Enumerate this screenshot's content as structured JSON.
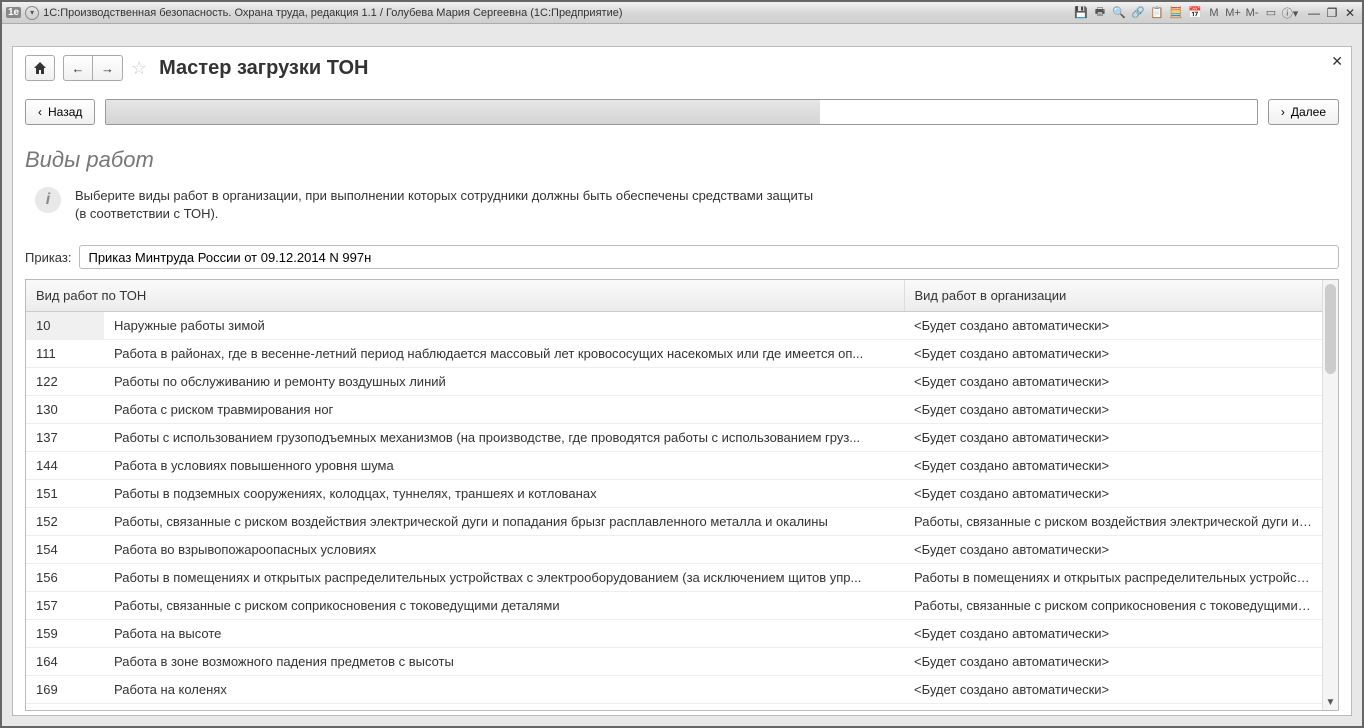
{
  "window": {
    "title": "1С:Производственная безопасность. Охрана труда, редакция 1.1 / Голубева Мария Сергеевна  (1С:Предприятие)"
  },
  "sysicons": {
    "m": "M",
    "mp": "M+",
    "mm": "M-"
  },
  "page": {
    "title": "Мастер загрузки ТОН",
    "back": "Назад",
    "next": "Далее",
    "section_title": "Виды работ",
    "hint_line1": "Выберите виды работ в организации, при выполнении которых сотрудники должны быть обеспечены средствами защиты",
    "hint_line2": "(в соответствии с ТОН).",
    "order_label": "Приказ:",
    "order_value": "Приказ Минтруда России от 09.12.2014 N 997н",
    "progress_percent": 62
  },
  "table": {
    "header_code_desc": "Вид работ по ТОН",
    "header_org": "Вид работ в организации",
    "auto_text": "<Будет создано автоматически>",
    "rows": [
      {
        "code": "10",
        "desc": "Наружные работы зимой",
        "org_auto": true
      },
      {
        "code": "111",
        "desc": "Работа в районах, где в весенне-летний период наблюдается массовый лет кровососущих насекомых или где имеется оп...",
        "org_auto": true
      },
      {
        "code": "122",
        "desc": "Работы по обслуживанию и ремонту воздушных линий",
        "org_auto": true
      },
      {
        "code": "130",
        "desc": "Работа с риском травмирования ног",
        "org_auto": true
      },
      {
        "code": "137",
        "desc": "Работы с использованием грузоподъемных механизмов (на производстве, где проводятся работы с использованием груз...",
        "org_auto": true
      },
      {
        "code": "144",
        "desc": "Работа в условиях повышенного уровня шума",
        "org_auto": true
      },
      {
        "code": "151",
        "desc": "Работы в подземных сооружениях, колодцах, туннелях, траншеях и котлованах",
        "org_auto": true
      },
      {
        "code": "152",
        "desc": "Работы, связанные с риском воздействия электрической дуги и попадания брызг расплавленного металла и окалины",
        "org_auto": false,
        "org": "Работы, связанные с риском воздействия электрической дуги и п..."
      },
      {
        "code": "154",
        "desc": "Работа во взрывопожароопасных условиях",
        "org_auto": true
      },
      {
        "code": "156",
        "desc": "Работы в помещениях и открытых распределительных устройствах с электрооборудованием (за исключением щитов упр...",
        "org_auto": false,
        "org": "Работы в помещениях и открытых распределительных устройств..."
      },
      {
        "code": "157",
        "desc": "Работы, связанные с риском соприкосновения с токоведущими деталями",
        "org_auto": false,
        "org": "Работы, связанные с риском соприкосновения с токоведущими ..."
      },
      {
        "code": "159",
        "desc": "Работа на высоте",
        "org_auto": true
      },
      {
        "code": "164",
        "desc": "Работа в зоне возможного падения предметов с высоты",
        "org_auto": true
      },
      {
        "code": "169",
        "desc": "Работа на коленях",
        "org_auto": true
      }
    ]
  }
}
